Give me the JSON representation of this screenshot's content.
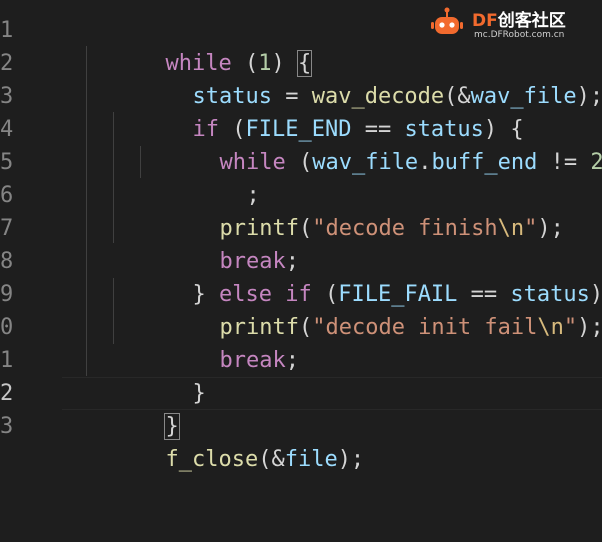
{
  "line_numbers": [
    "1",
    "2",
    "3",
    "4",
    "5",
    "6",
    "7",
    "8",
    "9",
    "0",
    "1",
    "2",
    "3"
  ],
  "watermark": {
    "brand_df": "DF",
    "brand_cn": "创客社区",
    "url": "mc.DFRobot.com.cn"
  },
  "code": {
    "l1": {
      "kw": "while",
      "open": " (",
      "num": "1",
      "close": ") ",
      "brace": "{"
    },
    "l2": {
      "var": "status",
      "eq": " = ",
      "fn": "wav_decode",
      "open": "(&",
      "arg": "wav_file",
      "close": ");"
    },
    "l3": {
      "kw": "if",
      "open": " (",
      "const": "FILE_END",
      "op": " == ",
      "var": "status",
      "close": ") {"
    },
    "l4": {
      "kw": "while",
      "open": " (",
      "obj": "wav_file",
      "dot": ".",
      "prop": "buff_end",
      "op": " != ",
      "num": "2",
      "close": ")"
    },
    "l5": {
      "semi": ";"
    },
    "l6": {
      "fn": "printf",
      "open": "(",
      "str": "\"decode finish",
      "esc": "\\n",
      "strend": "\"",
      "close": ");"
    },
    "l7": {
      "kw": "break",
      "semi": ";"
    },
    "l8": {
      "brace": "} ",
      "kw1": "else",
      "sp": " ",
      "kw2": "if",
      "open": " (",
      "const": "FILE_FAIL",
      "op": " == ",
      "var": "status",
      "close": ") {"
    },
    "l9": {
      "fn": "printf",
      "open": "(",
      "str": "\"decode init fail",
      "esc": "\\n",
      "strend": "\"",
      "close": ");"
    },
    "l10": {
      "kw": "break",
      "semi": ";"
    },
    "l11": {
      "brace": "}"
    },
    "l12": {
      "brace": "}"
    },
    "l13": {
      "fn": "f_close",
      "open": "(&",
      "arg": "file",
      "close": ");"
    }
  },
  "colors": {
    "background": "#1e1e1e",
    "keyword_control": "#c586c0",
    "variable": "#9cdcfe",
    "function": "#dcdcaa",
    "number": "#b5cea8",
    "string": "#ce9178",
    "escape": "#d7ba7d"
  }
}
